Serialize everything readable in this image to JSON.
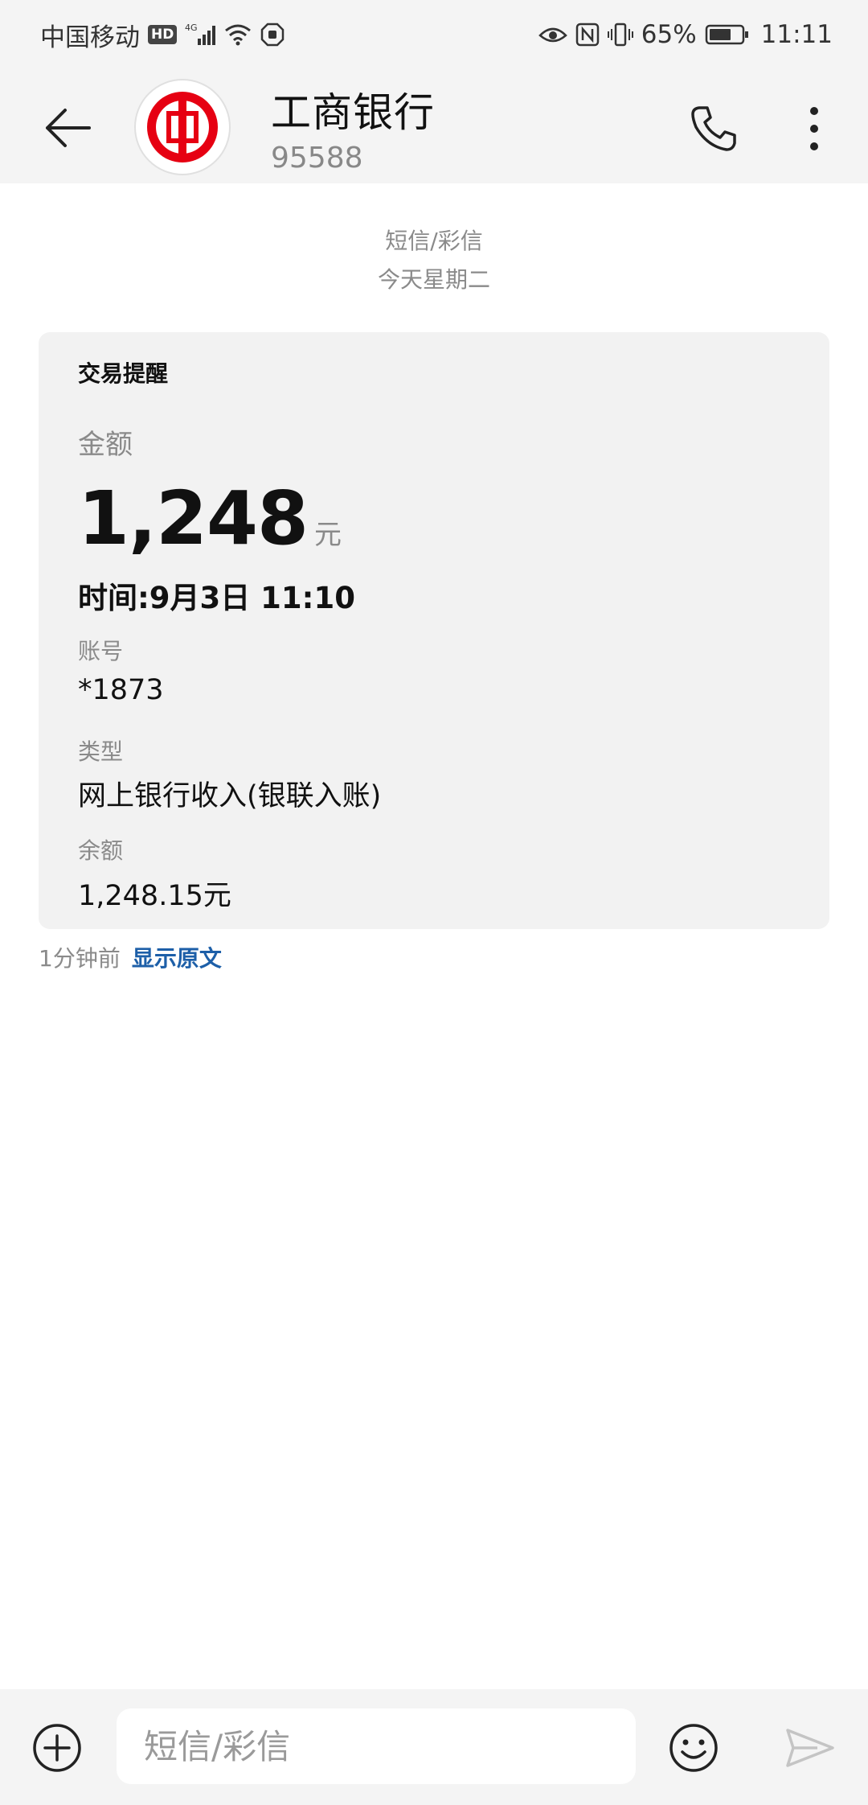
{
  "status_bar": {
    "carrier": "中国移动",
    "hd": "HD",
    "network": "4G",
    "battery": "65%",
    "time": "11:11",
    "icons": [
      "hd-icon",
      "signal-icon",
      "wifi-icon",
      "hand-icon",
      "eye-icon",
      "nfc-icon",
      "vibrate-icon",
      "battery-icon"
    ]
  },
  "header": {
    "contact_name": "工商银行",
    "contact_number": "95588",
    "logo_color": "#e60012",
    "icons": [
      "back-arrow-icon",
      "icbc-logo-icon",
      "phone-icon",
      "more-vertical-icon"
    ]
  },
  "conversation": {
    "message_type": "短信/彩信",
    "date": "今天星期二"
  },
  "card": {
    "title": "交易提醒",
    "amount_label": "金额",
    "amount_value": "1,248",
    "amount_unit": "元",
    "time_line": "时间:9月3日 11:10",
    "account_label": "账号",
    "account_value": "*1873",
    "type_label": "类型",
    "type_value": "网上银行收入(银联入账)",
    "balance_label": "余额",
    "balance_value": "1,248.15元"
  },
  "meta": {
    "time_ago": "1分钟前",
    "show_original": "显示原文"
  },
  "composer": {
    "placeholder": "短信/彩信",
    "icons": [
      "add-circle-icon",
      "emoji-icon",
      "send-icon"
    ]
  }
}
